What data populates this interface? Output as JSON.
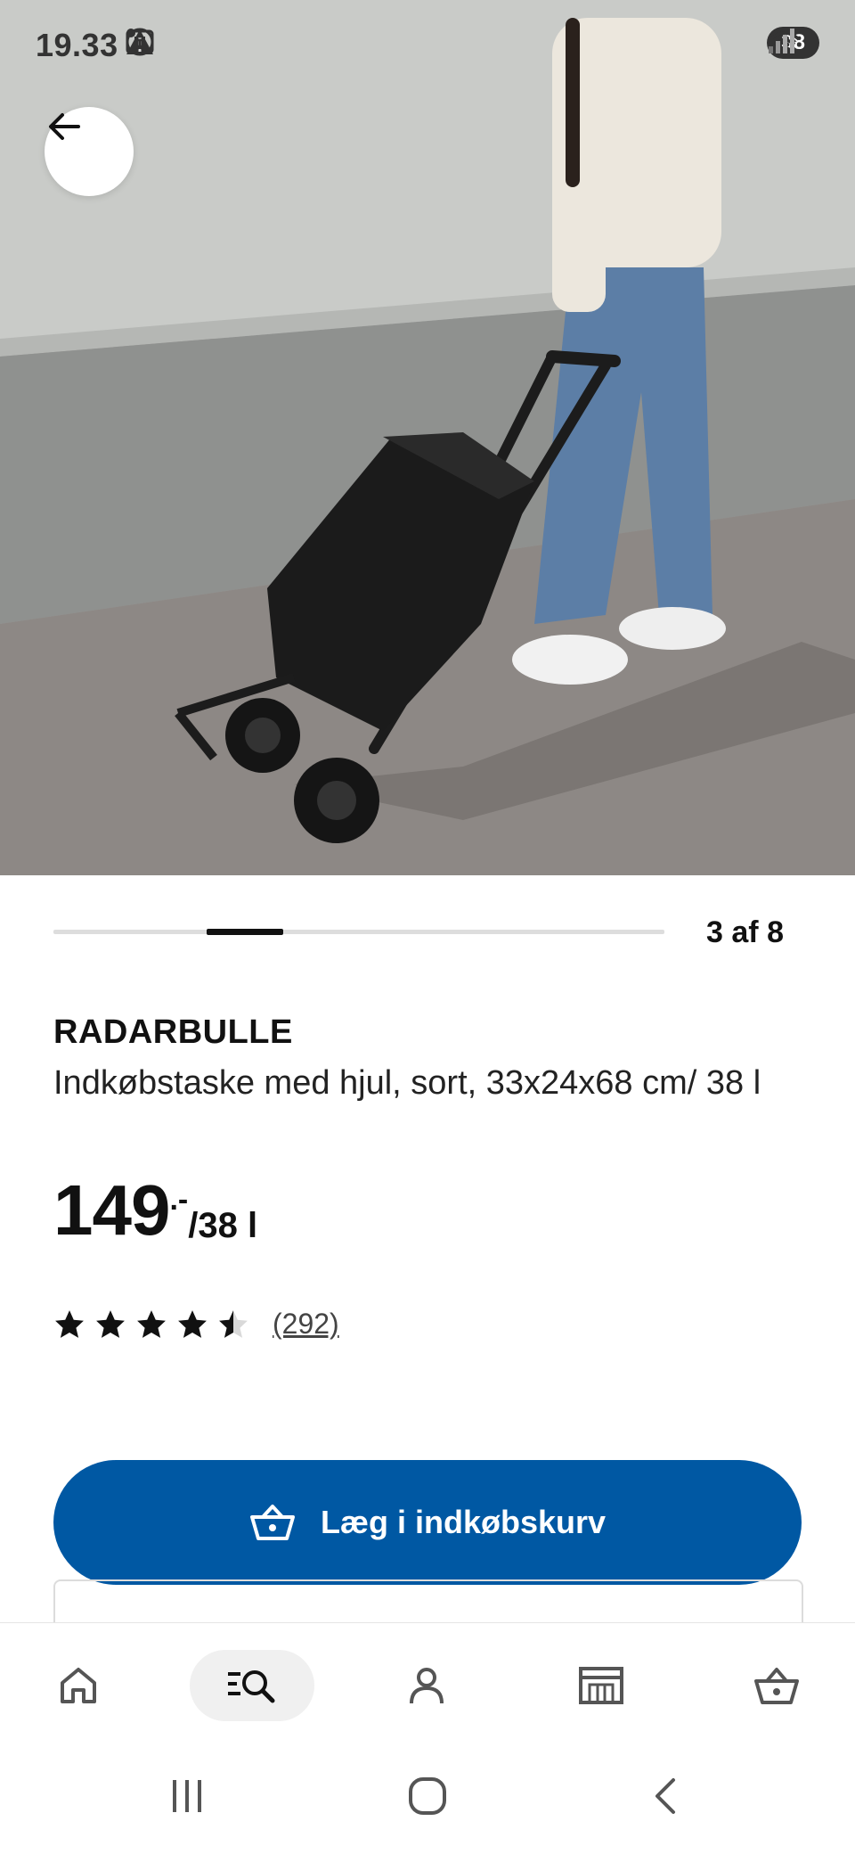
{
  "status_bar": {
    "time": "19.33",
    "battery": "38"
  },
  "carousel": {
    "counter": "3 af 8",
    "current": 3,
    "total": 8
  },
  "product": {
    "name": "RADARBULLE",
    "description": "Indkøbstaske med hjul, sort, 33x24x68 cm/ 38 l",
    "price": "149",
    "price_suffix": ".-",
    "price_unit": "/38 l",
    "rating_value": 4.5,
    "rating_max": 5,
    "review_count": "(292)"
  },
  "actions": {
    "add_to_cart_label": "Læg i indkøbskurv"
  },
  "bottom_nav": {
    "items": [
      {
        "icon": "home-icon"
      },
      {
        "icon": "search-icon",
        "active": true
      },
      {
        "icon": "profile-icon"
      },
      {
        "icon": "store-icon"
      },
      {
        "icon": "cart-icon"
      }
    ]
  },
  "colors": {
    "accent": "#0058a3",
    "text": "#111111"
  }
}
